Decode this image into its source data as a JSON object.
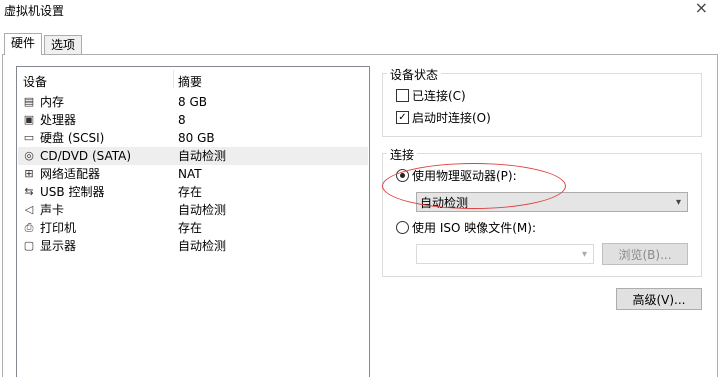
{
  "window": {
    "title": "虚拟机设置",
    "close_glyph": "×"
  },
  "tabs": [
    {
      "label": "硬件"
    },
    {
      "label": "选项"
    }
  ],
  "device_list": {
    "col_device": "设备",
    "col_summary": "摘要",
    "rows": [
      {
        "icon": "memory-icon",
        "name": "内存",
        "summary": "8 GB"
      },
      {
        "icon": "processor-icon",
        "name": "处理器",
        "summary": "8"
      },
      {
        "icon": "disk-icon",
        "name": "硬盘 (SCSI)",
        "summary": "80 GB"
      },
      {
        "icon": "cd-dvd-icon",
        "name": "CD/DVD (SATA)",
        "summary": "自动检测"
      },
      {
        "icon": "network-icon",
        "name": "网络适配器",
        "summary": "NAT"
      },
      {
        "icon": "usb-icon",
        "name": "USB 控制器",
        "summary": "存在"
      },
      {
        "icon": "sound-icon",
        "name": "声卡",
        "summary": "自动检测"
      },
      {
        "icon": "printer-icon",
        "name": "打印机",
        "summary": "存在"
      },
      {
        "icon": "display-icon",
        "name": "显示器",
        "summary": "自动检测"
      }
    ],
    "selected_index": 3
  },
  "device_status": {
    "title": "设备状态",
    "connected_label": "已连接(C)",
    "connected_checked": false,
    "connect_at_power_on_label": "启动时连接(O)",
    "connect_at_power_on_checked": true
  },
  "connection": {
    "title": "连接",
    "physical_label": "使用物理驱动器(P):",
    "physical_selected": true,
    "physical_value": "自动检测",
    "iso_label": "使用 ISO 映像文件(M):",
    "iso_selected": false,
    "iso_value": "",
    "browse_label": "浏览(B)..."
  },
  "advanced_label": "高级(V)...",
  "colors": {
    "annotation_ellipse": "#e04040",
    "selected_row": "#eeeeee"
  }
}
